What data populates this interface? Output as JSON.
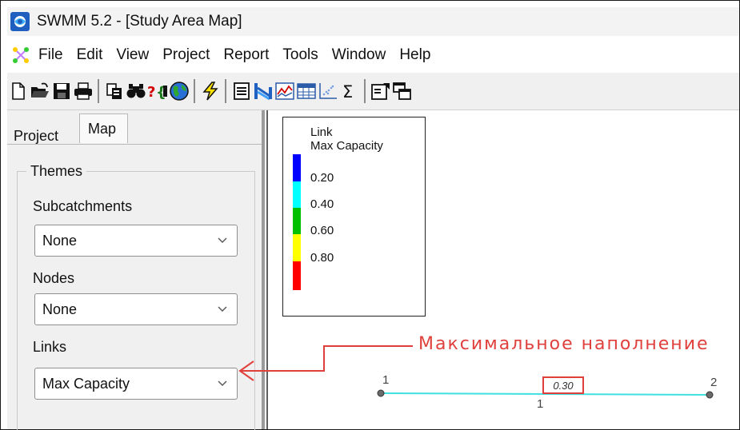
{
  "window": {
    "title": "SWMM 5.2 - [Study Area Map]"
  },
  "menu": [
    "File",
    "Edit",
    "View",
    "Project",
    "Report",
    "Tools",
    "Window",
    "Help"
  ],
  "toolbar": {
    "buttons": [
      "new-icon",
      "open-icon",
      "save-icon",
      "print-icon",
      "copy-icon",
      "find-icon",
      "query-icon",
      "map-options-icon",
      "run-icon",
      "status-report-icon",
      "profile-plot-icon",
      "time-series-plot-icon",
      "table-icon",
      "scatter-plot-icon",
      "statistics-icon",
      "options-icon",
      "arrange-windows-icon"
    ]
  },
  "left_panel": {
    "tabs": {
      "project": "Project",
      "map": "Map",
      "active": "Map"
    },
    "themes_title": "Themes",
    "subcatchments": {
      "label": "Subcatchments",
      "value": "None"
    },
    "nodes": {
      "label": "Nodes",
      "value": "None"
    },
    "links": {
      "label": "Links",
      "value": "Max Capacity"
    }
  },
  "legend": {
    "title_line1": "Link",
    "title_line2": "Max Capacity",
    "values": [
      "0.20",
      "0.40",
      "0.60",
      "0.80"
    ],
    "colors": [
      "#0000ff",
      "#00ffff",
      "#00c000",
      "#ffff00",
      "#ff0000"
    ]
  },
  "map": {
    "annotation": "Максимальное наполнение",
    "link_value": "0.30",
    "link_label": "1",
    "node_start_label": "1",
    "node_end_label": "2",
    "link_color": "#40e0e0",
    "annotation_color": "#e0403c"
  }
}
